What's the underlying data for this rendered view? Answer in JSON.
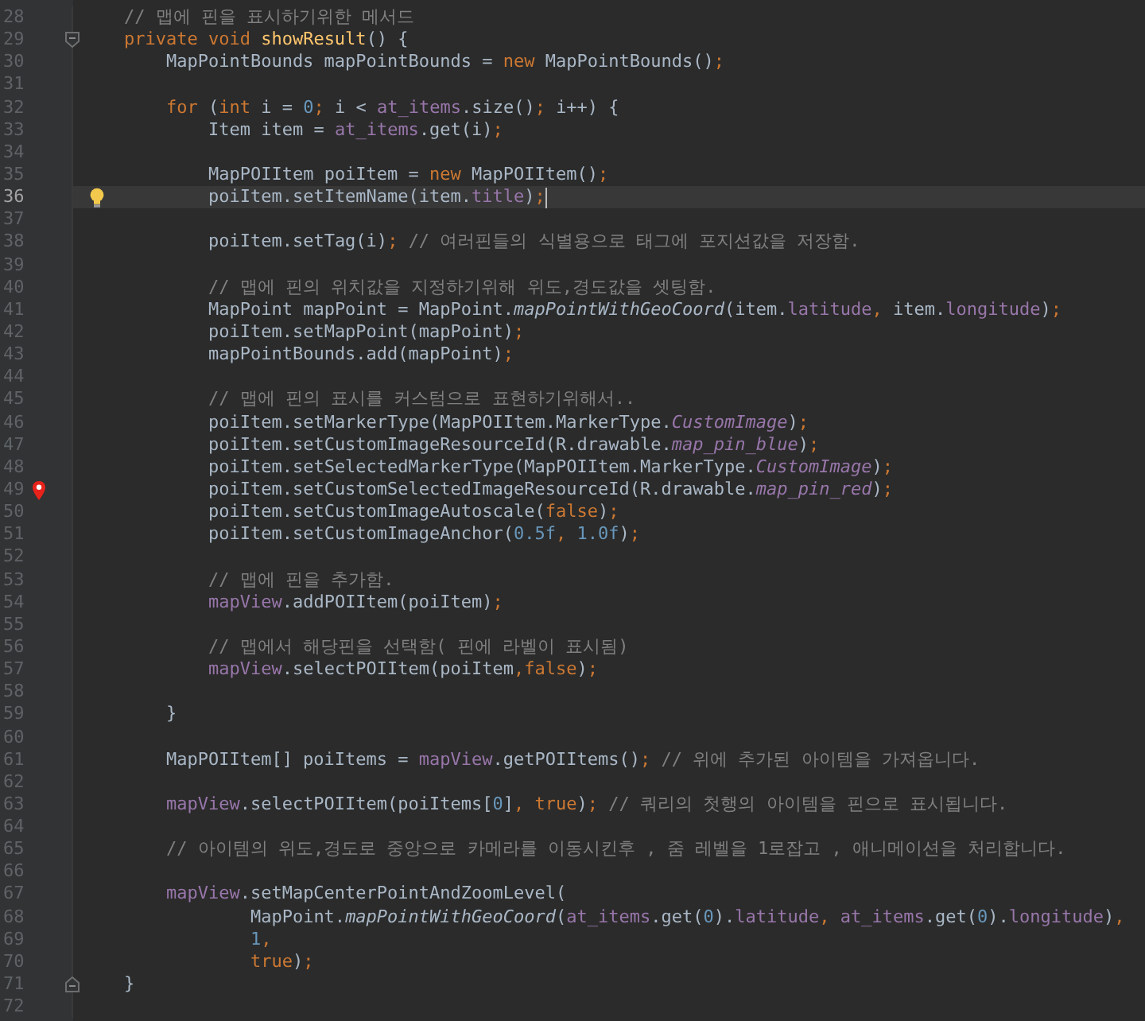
{
  "editor": {
    "lines": [
      {
        "number": "28",
        "current": false,
        "caret": false,
        "tokens": [
          {
            "kind": "comment",
            "text": "    // 맵에 핀을 표시하기위한 메서드"
          }
        ]
      },
      {
        "number": "29",
        "current": false,
        "caret": false,
        "marker": {
          "kind": "fold-start"
        },
        "tokens": [
          {
            "kind": "keyword",
            "text": "    private void "
          },
          {
            "kind": "method",
            "text": "showResult"
          },
          {
            "kind": "plain",
            "text": "() {"
          }
        ]
      },
      {
        "number": "30",
        "current": false,
        "caret": false,
        "tokens": [
          {
            "kind": "plain",
            "text": "        MapPointBounds mapPointBounds = "
          },
          {
            "kind": "keyword",
            "text": "new "
          },
          {
            "kind": "plain",
            "text": "MapPointBounds()"
          },
          {
            "kind": "keyword",
            "text": ";"
          }
        ]
      },
      {
        "number": "31",
        "current": false,
        "caret": false
      },
      {
        "number": "32",
        "current": false,
        "caret": false,
        "tokens": [
          {
            "kind": "keyword",
            "text": "        for "
          },
          {
            "kind": "plain",
            "text": "("
          },
          {
            "kind": "keyword",
            "text": "int "
          },
          {
            "kind": "plain",
            "text": "i = "
          },
          {
            "kind": "number",
            "text": "0"
          },
          {
            "kind": "keyword",
            "text": "; "
          },
          {
            "kind": "plain",
            "text": "i < "
          },
          {
            "kind": "field",
            "text": "at_items"
          },
          {
            "kind": "plain",
            "text": ".size()"
          },
          {
            "kind": "keyword",
            "text": "; "
          },
          {
            "kind": "plain",
            "text": "i++) {"
          }
        ]
      },
      {
        "number": "33",
        "current": false,
        "caret": false,
        "tokens": [
          {
            "kind": "plain",
            "text": "            Item item = "
          },
          {
            "kind": "field",
            "text": "at_items"
          },
          {
            "kind": "plain",
            "text": ".get(i)"
          },
          {
            "kind": "keyword",
            "text": ";"
          }
        ]
      },
      {
        "number": "34",
        "current": false,
        "caret": false
      },
      {
        "number": "35",
        "current": false,
        "caret": false,
        "tokens": [
          {
            "kind": "plain",
            "text": "            MapPOIItem poiItem = "
          },
          {
            "kind": "keyword",
            "text": "new "
          },
          {
            "kind": "plain",
            "text": "MapPOIItem()"
          },
          {
            "kind": "keyword",
            "text": ";"
          }
        ]
      },
      {
        "number": "36",
        "current": true,
        "caret": true,
        "marker": {
          "kind": "bulb"
        },
        "tokens": [
          {
            "kind": "plain",
            "text": "            poiItem.setItemName(item."
          },
          {
            "kind": "field",
            "text": "title"
          },
          {
            "kind": "plain",
            "text": ")"
          },
          {
            "kind": "keyword",
            "text": ";"
          }
        ]
      },
      {
        "number": "37",
        "current": false,
        "caret": false
      },
      {
        "number": "38",
        "current": false,
        "caret": false,
        "tokens": [
          {
            "kind": "plain",
            "text": "            poiItem.setTag(i)"
          },
          {
            "kind": "keyword",
            "text": "; "
          },
          {
            "kind": "comment",
            "text": "// 여러핀들의 식별용으로 태그에 포지션값을 저장함."
          }
        ]
      },
      {
        "number": "39",
        "current": false,
        "caret": false
      },
      {
        "number": "40",
        "current": false,
        "caret": false,
        "tokens": [
          {
            "kind": "comment",
            "text": "            // 맵에 핀의 위치값을 지정하기위해 위도,경도값을 셋팅함."
          }
        ]
      },
      {
        "number": "41",
        "current": false,
        "caret": false,
        "tokens": [
          {
            "kind": "plain",
            "text": "            MapPoint mapPoint = MapPoint."
          },
          {
            "kind": "static",
            "text": "mapPointWithGeoCoord"
          },
          {
            "kind": "plain",
            "text": "(item."
          },
          {
            "kind": "field",
            "text": "latitude"
          },
          {
            "kind": "keyword",
            "text": ", "
          },
          {
            "kind": "plain",
            "text": "item."
          },
          {
            "kind": "field",
            "text": "longitude"
          },
          {
            "kind": "plain",
            "text": ")"
          },
          {
            "kind": "keyword",
            "text": ";"
          }
        ]
      },
      {
        "number": "42",
        "current": false,
        "caret": false,
        "tokens": [
          {
            "kind": "plain",
            "text": "            poiItem.setMapPoint(mapPoint)"
          },
          {
            "kind": "keyword",
            "text": ";"
          }
        ]
      },
      {
        "number": "43",
        "current": false,
        "caret": false,
        "tokens": [
          {
            "kind": "plain",
            "text": "            mapPointBounds.add(mapPoint)"
          },
          {
            "kind": "keyword",
            "text": ";"
          }
        ]
      },
      {
        "number": "44",
        "current": false,
        "caret": false
      },
      {
        "number": "45",
        "current": false,
        "caret": false,
        "tokens": [
          {
            "kind": "comment",
            "text": "            // 맵에 핀의 표시를 커스텀으로 표현하기위해서.."
          }
        ]
      },
      {
        "number": "46",
        "current": false,
        "caret": false,
        "tokens": [
          {
            "kind": "plain",
            "text": "            poiItem.setMarkerType(MapPOIItem.MarkerType."
          },
          {
            "kind": "constant",
            "text": "CustomImage"
          },
          {
            "kind": "plain",
            "text": ")"
          },
          {
            "kind": "keyword",
            "text": ";"
          }
        ]
      },
      {
        "number": "47",
        "current": false,
        "caret": false,
        "tokens": [
          {
            "kind": "plain",
            "text": "            poiItem.setCustomImageResourceId(R.drawable."
          },
          {
            "kind": "constant",
            "text": "map_pin_blue"
          },
          {
            "kind": "plain",
            "text": ")"
          },
          {
            "kind": "keyword",
            "text": ";"
          }
        ]
      },
      {
        "number": "48",
        "current": false,
        "caret": false,
        "tokens": [
          {
            "kind": "plain",
            "text": "            poiItem.setSelectedMarkerType(MapPOIItem.MarkerType."
          },
          {
            "kind": "constant",
            "text": "CustomImage"
          },
          {
            "kind": "plain",
            "text": ")"
          },
          {
            "kind": "keyword",
            "text": ";"
          }
        ]
      },
      {
        "number": "49",
        "current": false,
        "caret": false,
        "marker": {
          "kind": "pin"
        },
        "tokens": [
          {
            "kind": "plain",
            "text": "            poiItem.setCustomSelectedImageResourceId(R.drawable."
          },
          {
            "kind": "constant",
            "text": "map_pin_red"
          },
          {
            "kind": "plain",
            "text": ")"
          },
          {
            "kind": "keyword",
            "text": ";"
          }
        ]
      },
      {
        "number": "50",
        "current": false,
        "caret": false,
        "tokens": [
          {
            "kind": "plain",
            "text": "            poiItem.setCustomImageAutoscale("
          },
          {
            "kind": "keyword",
            "text": "false"
          },
          {
            "kind": "plain",
            "text": ")"
          },
          {
            "kind": "keyword",
            "text": ";"
          }
        ]
      },
      {
        "number": "51",
        "current": false,
        "caret": false,
        "tokens": [
          {
            "kind": "plain",
            "text": "            poiItem.setCustomImageAnchor("
          },
          {
            "kind": "number",
            "text": "0.5f"
          },
          {
            "kind": "keyword",
            "text": ", "
          },
          {
            "kind": "number",
            "text": "1.0f"
          },
          {
            "kind": "plain",
            "text": ")"
          },
          {
            "kind": "keyword",
            "text": ";"
          }
        ]
      },
      {
        "number": "52",
        "current": false,
        "caret": false
      },
      {
        "number": "53",
        "current": false,
        "caret": false,
        "tokens": [
          {
            "kind": "comment",
            "text": "            // 맵에 핀을 추가함."
          }
        ]
      },
      {
        "number": "54",
        "current": false,
        "caret": false,
        "tokens": [
          {
            "kind": "field",
            "text": "            mapView"
          },
          {
            "kind": "plain",
            "text": ".addPOIItem(poiItem)"
          },
          {
            "kind": "keyword",
            "text": ";"
          }
        ]
      },
      {
        "number": "55",
        "current": false,
        "caret": false
      },
      {
        "number": "56",
        "current": false,
        "caret": false,
        "tokens": [
          {
            "kind": "comment",
            "text": "            // 맵에서 해당핀을 선택함( 핀에 라벨이 표시됨)"
          }
        ]
      },
      {
        "number": "57",
        "current": false,
        "caret": false,
        "tokens": [
          {
            "kind": "field",
            "text": "            mapView"
          },
          {
            "kind": "plain",
            "text": ".selectPOIItem(poiItem"
          },
          {
            "kind": "keyword",
            "text": ",false"
          },
          {
            "kind": "plain",
            "text": ")"
          },
          {
            "kind": "keyword",
            "text": ";"
          }
        ]
      },
      {
        "number": "58",
        "current": false,
        "caret": false
      },
      {
        "number": "59",
        "current": false,
        "caret": false,
        "tokens": [
          {
            "kind": "plain",
            "text": "        }"
          }
        ]
      },
      {
        "number": "60",
        "current": false,
        "caret": false
      },
      {
        "number": "61",
        "current": false,
        "caret": false,
        "tokens": [
          {
            "kind": "plain",
            "text": "        MapPOIItem[] poiItems = "
          },
          {
            "kind": "field",
            "text": "mapView"
          },
          {
            "kind": "plain",
            "text": ".getPOIItems()"
          },
          {
            "kind": "keyword",
            "text": "; "
          },
          {
            "kind": "comment",
            "text": "// 위에 추가된 아이템을 가져옵니다."
          }
        ]
      },
      {
        "number": "62",
        "current": false,
        "caret": false
      },
      {
        "number": "63",
        "current": false,
        "caret": false,
        "tokens": [
          {
            "kind": "field",
            "text": "        mapView"
          },
          {
            "kind": "plain",
            "text": ".selectPOIItem(poiItems["
          },
          {
            "kind": "number",
            "text": "0"
          },
          {
            "kind": "plain",
            "text": "]"
          },
          {
            "kind": "keyword",
            "text": ", true"
          },
          {
            "kind": "plain",
            "text": ")"
          },
          {
            "kind": "keyword",
            "text": "; "
          },
          {
            "kind": "comment",
            "text": "// 쿼리의 첫행의 아이템을 핀으로 표시됩니다."
          }
        ]
      },
      {
        "number": "64",
        "current": false,
        "caret": false
      },
      {
        "number": "65",
        "current": false,
        "caret": false,
        "tokens": [
          {
            "kind": "comment",
            "text": "        // 아이템의 위도,경도로 중앙으로 카메라를 이동시킨후 , 줌 레벨을 1로잡고 , 애니메이션을 처리합니다."
          }
        ]
      },
      {
        "number": "66",
        "current": false,
        "caret": false
      },
      {
        "number": "67",
        "current": false,
        "caret": false,
        "tokens": [
          {
            "kind": "field",
            "text": "        mapView"
          },
          {
            "kind": "plain",
            "text": ".setMapCenterPointAndZoomLevel("
          }
        ]
      },
      {
        "number": "68",
        "current": false,
        "caret": false,
        "tokens": [
          {
            "kind": "plain",
            "text": "                MapPoint."
          },
          {
            "kind": "static",
            "text": "mapPointWithGeoCoord"
          },
          {
            "kind": "plain",
            "text": "("
          },
          {
            "kind": "field",
            "text": "at_items"
          },
          {
            "kind": "plain",
            "text": ".get("
          },
          {
            "kind": "number",
            "text": "0"
          },
          {
            "kind": "plain",
            "text": ")."
          },
          {
            "kind": "field",
            "text": "latitude"
          },
          {
            "kind": "keyword",
            "text": ", "
          },
          {
            "kind": "field",
            "text": "at_items"
          },
          {
            "kind": "plain",
            "text": ".get("
          },
          {
            "kind": "number",
            "text": "0"
          },
          {
            "kind": "plain",
            "text": ")."
          },
          {
            "kind": "field",
            "text": "longitude"
          },
          {
            "kind": "plain",
            "text": ")"
          },
          {
            "kind": "keyword",
            "text": ","
          }
        ]
      },
      {
        "number": "69",
        "current": false,
        "caret": false,
        "tokens": [
          {
            "kind": "number",
            "text": "                1"
          },
          {
            "kind": "keyword",
            "text": ","
          }
        ]
      },
      {
        "number": "70",
        "current": false,
        "caret": false,
        "tokens": [
          {
            "kind": "keyword",
            "text": "                true"
          },
          {
            "kind": "plain",
            "text": ")"
          },
          {
            "kind": "keyword",
            "text": ";"
          }
        ]
      },
      {
        "number": "71",
        "current": false,
        "caret": false,
        "marker": {
          "kind": "fold-end"
        },
        "tokens": [
          {
            "kind": "plain",
            "text": "    }"
          }
        ]
      },
      {
        "number": "72",
        "current": false,
        "caret": false
      }
    ]
  }
}
